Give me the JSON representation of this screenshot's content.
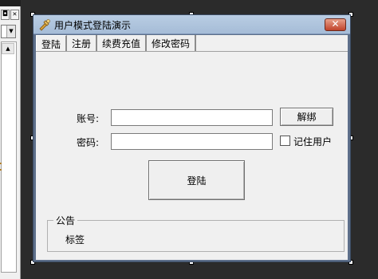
{
  "window": {
    "title": "用户模式登陆演示",
    "close_symbol": "✕"
  },
  "tabs": [
    {
      "label": "登陆"
    },
    {
      "label": "注册"
    },
    {
      "label": "续费充值"
    },
    {
      "label": "修改密码"
    }
  ],
  "form": {
    "account_label": "账号:",
    "password_label": "密码:",
    "account_value": "",
    "password_value": "",
    "unbind_button": "解绑",
    "remember_label": "记住用户",
    "login_button": "登陆"
  },
  "notice": {
    "group_title": "公告",
    "content": "标签"
  },
  "ide": {
    "btn1": "◘",
    "btn2": "✕",
    "combo_arrow": "▼",
    "scroll_up": "▲"
  },
  "colors": {
    "titlebar": "#b9cde3",
    "close_button": "#c0432a",
    "client_bg": "#f0f0f0",
    "desktop_bg": "#2b2b2b"
  },
  "icons": [
    "app-icon",
    "close-icon",
    "checkbox"
  ]
}
